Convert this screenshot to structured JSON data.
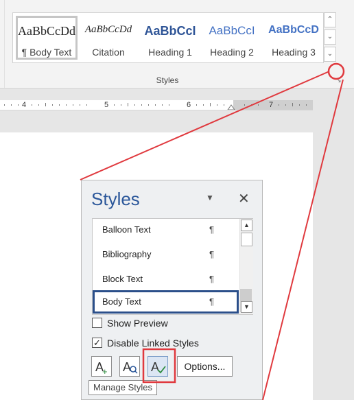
{
  "ribbon": {
    "styles": [
      {
        "sample": "AaBbCcDd",
        "name": "¶ Body Text",
        "selected": true
      },
      {
        "sample": "AaBbCcDd",
        "name": "Citation"
      },
      {
        "sample": "AaBbCcI",
        "name": "Heading 1"
      },
      {
        "sample": "AaBbCcI",
        "name": "Heading 2"
      },
      {
        "sample": "AaBbCcD",
        "name": "Heading 3"
      }
    ],
    "group_label": "Styles",
    "scroll_up_icon": "chevron-up-icon",
    "scroll_down_icon": "chevron-down-icon",
    "more_icon": "more-icon",
    "launcher_icon": "dialog-launcher-icon"
  },
  "ruler": {
    "labels": [
      "4",
      "5",
      "6",
      "7"
    ]
  },
  "pane": {
    "title": "Styles",
    "menu_icon": "dropdown-triangle-icon",
    "close_icon": "close-icon",
    "items": [
      {
        "label": "Balloon Text",
        "mark": "¶"
      },
      {
        "label": "Bibliography",
        "mark": "¶"
      },
      {
        "label": "Block Text",
        "mark": "¶"
      },
      {
        "label": "Body Text",
        "mark": "¶",
        "selected": true
      }
    ],
    "show_preview": {
      "label": "Show Preview",
      "checked": false
    },
    "disable_linked": {
      "label": "Disable Linked Styles",
      "checked": true,
      "mark": "✓"
    },
    "new_style_icon": "new-style-icon",
    "inspector_icon": "style-inspector-icon",
    "manage_icon": "manage-styles-icon",
    "options_label": "Options...",
    "tooltip": "Manage Styles"
  },
  "colors": {
    "accent": "#2b579a",
    "callout": "#e0393e",
    "selection": "#2b4f8a"
  }
}
